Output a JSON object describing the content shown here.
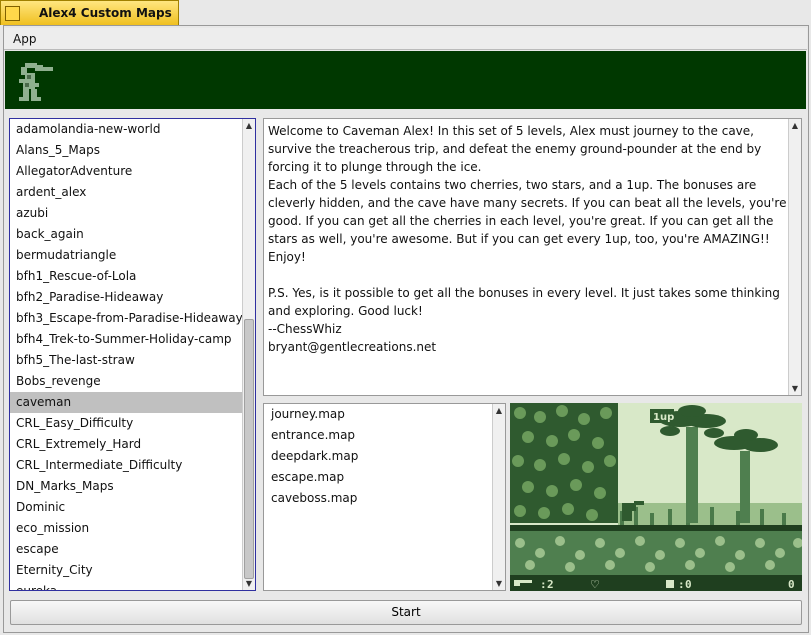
{
  "window": {
    "title": "Alex4 Custom Maps"
  },
  "menu": {
    "app": "App"
  },
  "map_sets": [
    "adamolandia-new-world",
    "Alans_5_Maps",
    "AllegatorAdventure",
    "ardent_alex",
    "azubi",
    "back_again",
    "bermudatriangle",
    "bfh1_Rescue-of-Lola",
    "bfh2_Paradise-Hideaway",
    "bfh3_Escape-from-Paradise-Hideaway",
    "bfh4_Trek-to-Summer-Holiday-camp",
    "bfh5_The-last-straw",
    "Bobs_revenge",
    "caveman",
    "CRL_Easy_Difficulty",
    "CRL_Extremely_Hard",
    "CRL_Intermediate_Difficulty",
    "DN_Marks_Maps",
    "Dominic",
    "eco_mission",
    "escape",
    "Eternity_City",
    "eureka"
  ],
  "selected_map_set": "caveman",
  "description": "Welcome to Caveman Alex! In this set of 5 levels, Alex must journey to the cave, survive the treacherous trip, and defeat the enemy ground-pounder at the end by forcing it to plunge through the ice.\nEach of the 5 levels contains two cherries, two stars, and a 1up. The bonuses are cleverly hidden, and the cave have many secrets. If you can beat all the levels, you're good. If you can get all the cherries in each level, you're great. If you can get all the stars as well, you're awesome. But if you can get every 1up, too, you're AMAZING!!\nEnjoy!\n\nP.S. Yes, is it possible to get all the bonuses in every level. It just takes some thinking and exploring. Good luck!\n--ChessWhiz\nbryant@gentlecreations.net",
  "map_files": [
    "journey.map",
    "entrance.map",
    "deepdark.map",
    "escape.map",
    "caveboss.map"
  ],
  "preview_hud": {
    "lives": "2",
    "stones": "0",
    "score": "0",
    "one_up": "1up"
  },
  "start_label": "Start",
  "colors": {
    "banner": "#003800",
    "selection": "#c0c0c0",
    "title_tab": "#f0c020"
  }
}
